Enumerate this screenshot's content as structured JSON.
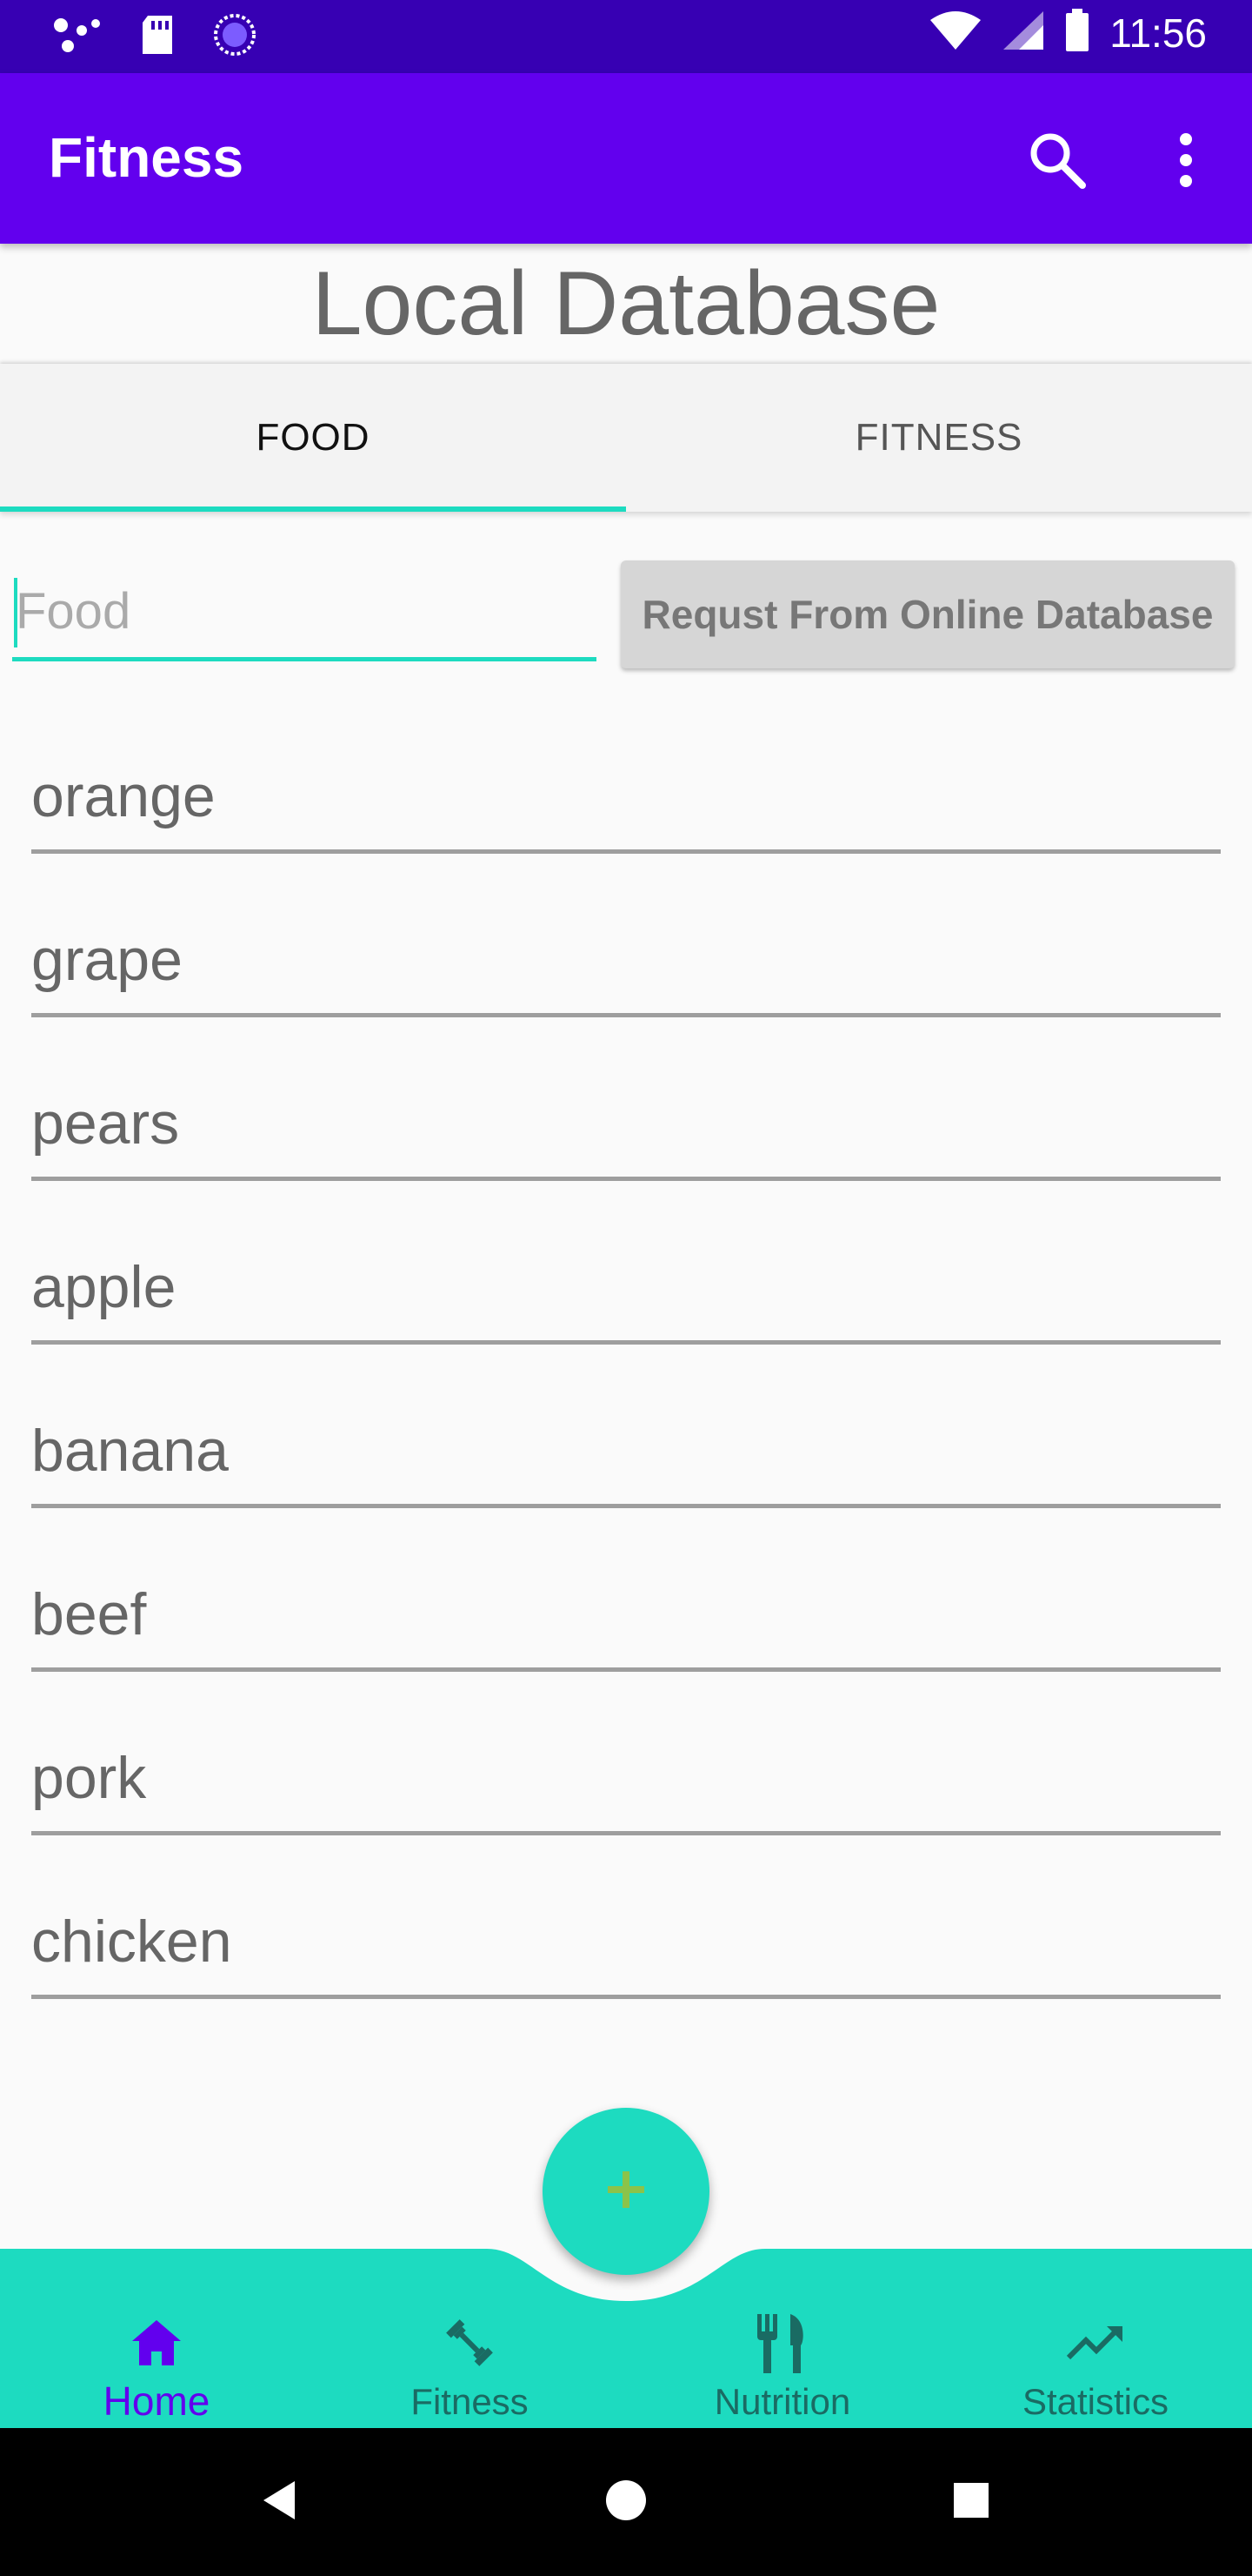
{
  "status_bar": {
    "time": "11:56"
  },
  "app_bar": {
    "title": "Fitness",
    "search_icon": "search-icon",
    "more_icon": "more-vert-icon"
  },
  "page_title": "Local Database",
  "tabs": [
    {
      "label": "FOOD",
      "selected": true
    },
    {
      "label": "FITNESS",
      "selected": false
    }
  ],
  "search": {
    "placeholder": "Food",
    "value": "",
    "request_button": "Requst From Online Database"
  },
  "food_items": [
    "orange",
    "grape",
    "pears",
    "apple",
    "banana",
    "beef",
    "pork",
    "chicken"
  ],
  "fab": {
    "icon": "plus-icon"
  },
  "bottom_nav": [
    {
      "label": "Home",
      "icon": "home-icon",
      "active": true
    },
    {
      "label": "Fitness",
      "icon": "dumbbell-icon",
      "active": false
    },
    {
      "label": "Nutrition",
      "icon": "fork-knife-icon",
      "active": false
    },
    {
      "label": "Statistics",
      "icon": "trending-up-icon",
      "active": false
    }
  ],
  "colors": {
    "primary": "#6200ee",
    "primary_dark": "#3700b3",
    "accent": "#1ddbc0"
  }
}
